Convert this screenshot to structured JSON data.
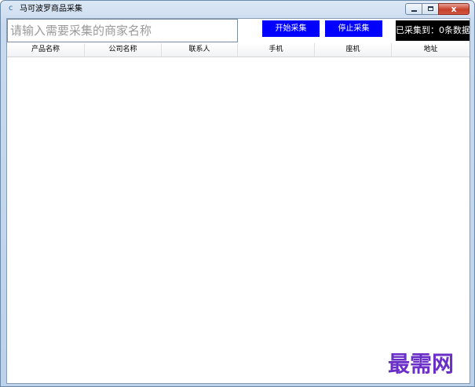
{
  "window": {
    "title": "马可波罗商品采集",
    "minimize_label": "",
    "maximize_label": "",
    "close_label": "x"
  },
  "toolbar": {
    "search_placeholder": "请输入需要采集的商家名称",
    "start_label": "开始采集",
    "stop_label": "停止采集",
    "status_text": "已采集到：0条数据"
  },
  "table": {
    "columns": [
      "产品名称",
      "公司名称",
      "联系人",
      "手机",
      "座机",
      "地址"
    ],
    "rows": []
  },
  "watermark": {
    "text": "最需网"
  },
  "colors": {
    "button_bg": "#0000ff",
    "status_bg": "#000000",
    "watermark": "#6a2fc7"
  }
}
